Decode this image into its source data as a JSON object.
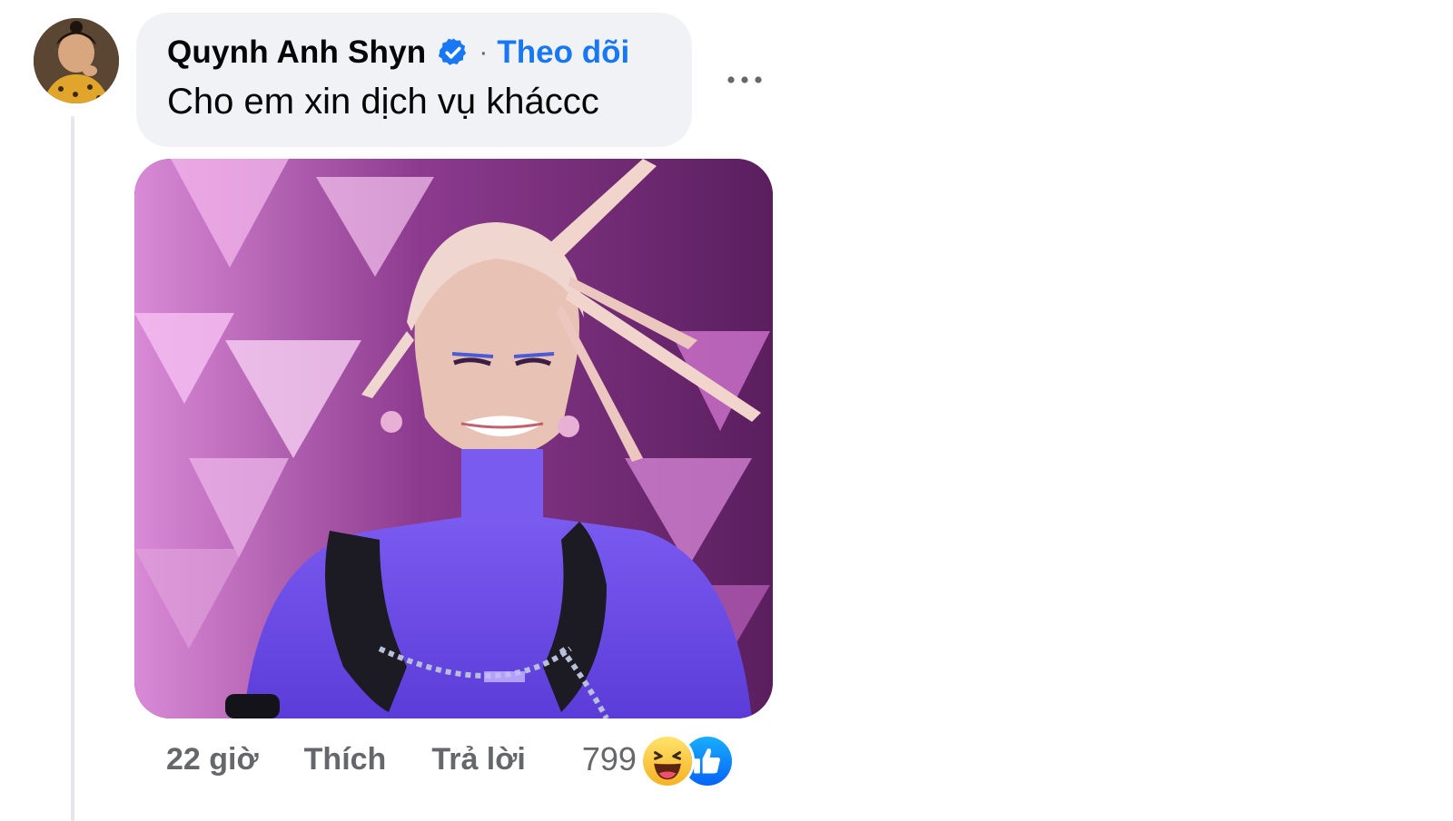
{
  "comment": {
    "author": "Quynh Anh Shyn",
    "verified": true,
    "separator": "·",
    "follow_label": "Theo dõi",
    "text": "Cho em xin dịch vụ kháccc",
    "media_description": "GIF reaction image",
    "time": "22 giờ",
    "like_label": "Thích",
    "reply_label": "Trả lời",
    "reaction_count": "799",
    "reactions": [
      "haha-icon",
      "like-icon"
    ]
  },
  "colors": {
    "link_blue": "#1877f2",
    "bubble_bg": "#f0f2f5",
    "secondary_text": "#65676b"
  },
  "icons": {
    "verified": "verified-badge-icon",
    "more": "more-options-icon"
  }
}
